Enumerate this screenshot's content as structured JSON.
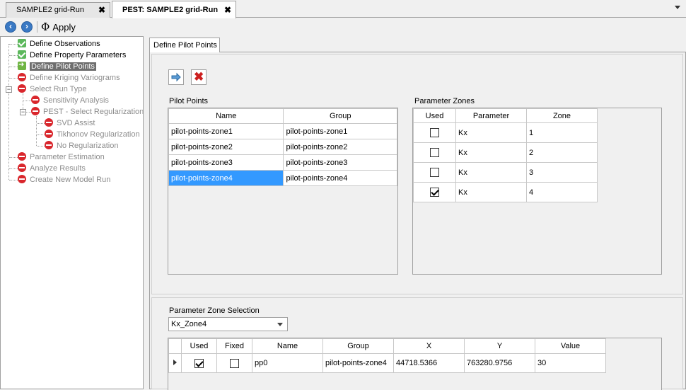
{
  "doc_tabs": [
    {
      "label": "SAMPLE2 grid-Run",
      "close": "✖"
    },
    {
      "label": "PEST: SAMPLE2 grid-Run",
      "close": "✖"
    }
  ],
  "toolbar": {
    "apply_label": "Apply",
    "apply_symbol": "Φ"
  },
  "tree": {
    "items": [
      {
        "label": "Define Observations"
      },
      {
        "label": "Define Property Parameters"
      },
      {
        "label": "Define Pilot Points"
      },
      {
        "label": "Define Kriging Variograms"
      },
      {
        "label": "Select Run Type"
      },
      {
        "label": "Sensitivity Analysis"
      },
      {
        "label": "PEST - Select Regularization"
      },
      {
        "label": "SVD Assist"
      },
      {
        "label": "Tikhonov Regularization"
      },
      {
        "label": "No Regularization"
      },
      {
        "label": "Parameter Estimation"
      },
      {
        "label": "Analyze Results"
      },
      {
        "label": "Create New Model Run"
      }
    ]
  },
  "panel": {
    "tab_label": "Define Pilot Points",
    "pilot_points": {
      "title": "Pilot Points",
      "columns": [
        "Name",
        "Group"
      ],
      "rows": [
        {
          "name": "pilot-points-zone1",
          "group": "pilot-points-zone1"
        },
        {
          "name": "pilot-points-zone2",
          "group": "pilot-points-zone2"
        },
        {
          "name": "pilot-points-zone3",
          "group": "pilot-points-zone3"
        },
        {
          "name": "pilot-points-zone4",
          "group": "pilot-points-zone4"
        }
      ]
    },
    "parameter_zones": {
      "title": "Parameter Zones",
      "columns": [
        "Used",
        "Parameter",
        "Zone"
      ],
      "rows": [
        {
          "used": false,
          "parameter": "Kx",
          "zone": "1"
        },
        {
          "used": false,
          "parameter": "Kx",
          "zone": "2"
        },
        {
          "used": false,
          "parameter": "Kx",
          "zone": "3"
        },
        {
          "used": true,
          "parameter": "Kx",
          "zone": "4"
        }
      ]
    },
    "zone_selection": {
      "title": "Parameter Zone Selection",
      "selected": "Kx_Zone4",
      "columns": [
        "Used",
        "Fixed",
        "Name",
        "Group",
        "X",
        "Y",
        "Value"
      ],
      "rows": [
        {
          "used": true,
          "fixed": false,
          "name": "pp0",
          "group": "pilot-points-zone4",
          "x": "44718.5366",
          "y": "763280.9756",
          "value": "30"
        }
      ]
    }
  }
}
